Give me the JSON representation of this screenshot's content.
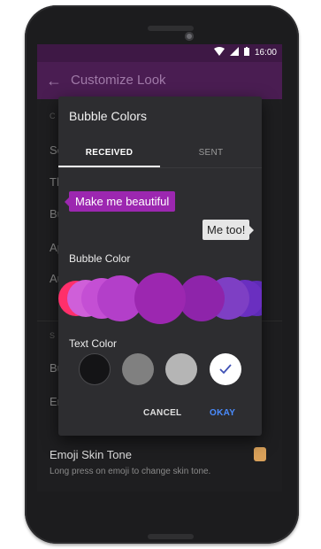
{
  "status_bar": {
    "time": "16:00"
  },
  "app_bar": {
    "title": "Customize Look"
  },
  "background_settings": {
    "rows": [
      "So",
      "Th",
      "Bu",
      "Ap",
      "Au",
      "Bu",
      "En"
    ],
    "emoji_skin_tone": {
      "title": "Emoji Skin Tone",
      "subtitle": "Long press on emoji to change skin tone."
    }
  },
  "dialog": {
    "title": "Bubble Colors",
    "tabs": [
      {
        "label": "RECEIVED",
        "selected": true
      },
      {
        "label": "SENT",
        "selected": false
      }
    ],
    "preview": {
      "received_text": "Make me beautiful",
      "sent_text": "Me too!"
    },
    "bubble_color_label": "Bubble Color",
    "bubble_colors": [
      "#ff2f6b",
      "#cf5fd9",
      "#c44fd4",
      "#b33fc9",
      "#9c27b0",
      "#8e24aa",
      "#7e3fc4",
      "#6a2fc0",
      "#5d2bb5",
      "#9b2cf0"
    ],
    "selected_bubble_color": "#9c27b0",
    "text_color_label": "Text Color",
    "text_colors": [
      "#141416",
      "#808080",
      "#b5b5b5",
      "#ffffff"
    ],
    "selected_text_color": "#ffffff",
    "buttons": {
      "cancel": "CANCEL",
      "okay": "OKAY"
    }
  },
  "colors": {
    "accent": "#4a8cff",
    "app_bar": "#4a1d52"
  }
}
